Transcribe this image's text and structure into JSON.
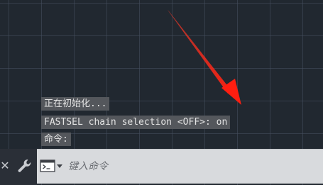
{
  "command_history": {
    "lines": [
      "正在初始化...",
      "FASTSEL chain selection <OFF>: on",
      "命令:"
    ]
  },
  "command_line": {
    "input_placeholder": "键入命令",
    "input_value": ""
  },
  "icons": {
    "close": "close-icon",
    "settings": "wrench-icon",
    "command_menu": "terminal-icon",
    "dropdown": "triangle-down-icon"
  },
  "colors": {
    "canvas_background": "#212830",
    "grid_lines": "#465060",
    "history_highlight": "#54575c",
    "command_bar": "#d8dadd",
    "annotation_arrow": "#ff2a1a"
  }
}
